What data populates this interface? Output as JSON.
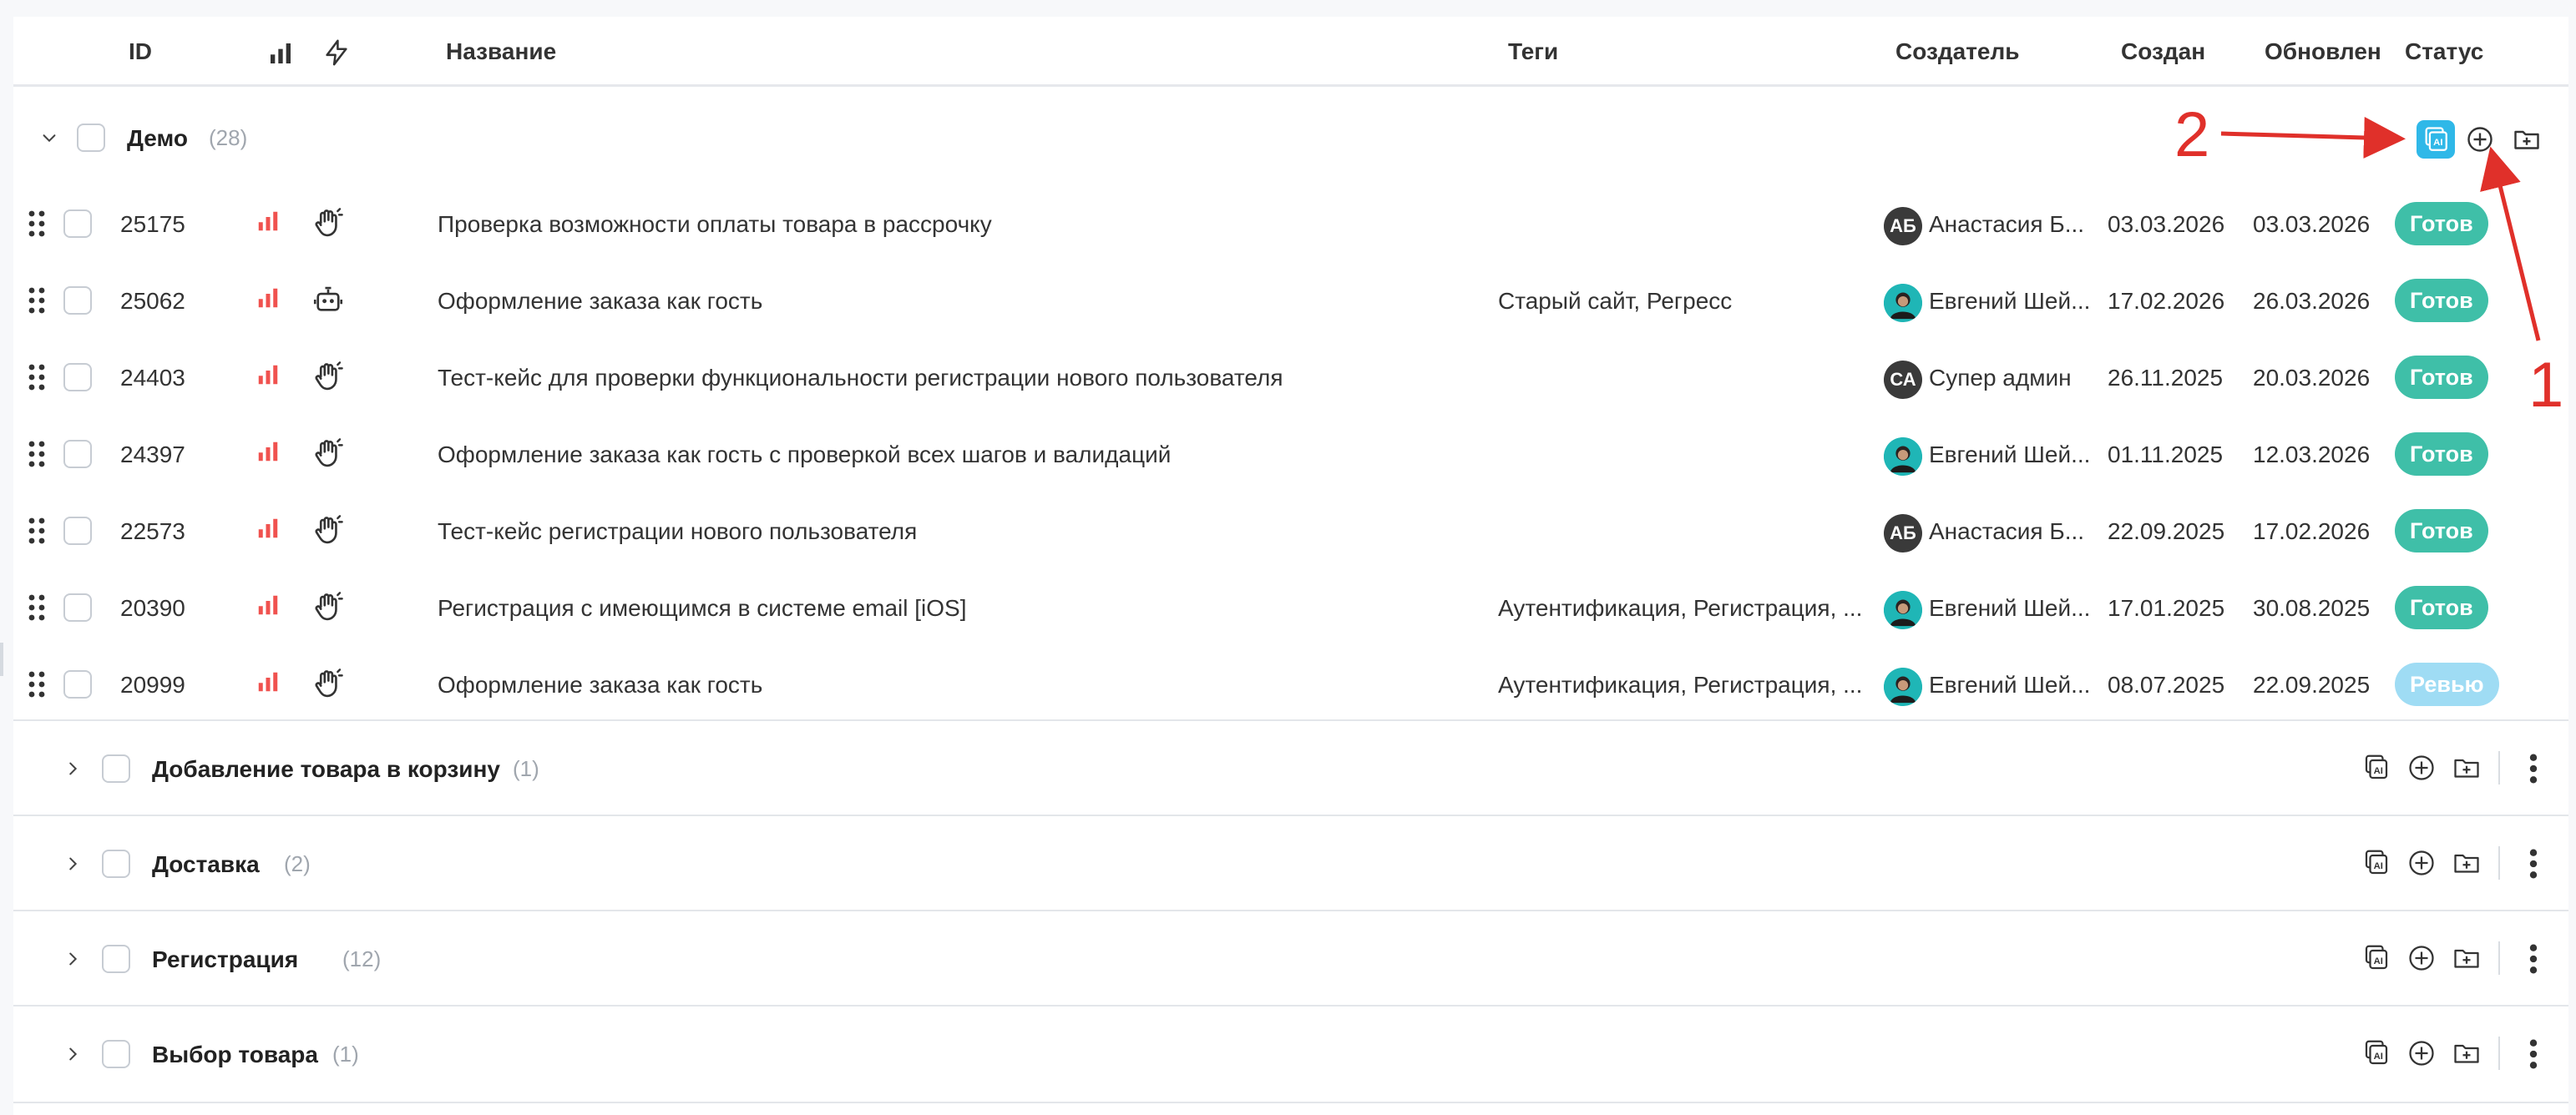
{
  "columns": {
    "id": "ID",
    "name": "Название",
    "tags": "Теги",
    "creator": "Создатель",
    "created": "Создан",
    "updated": "Обновлен",
    "status": "Статус"
  },
  "icons": {
    "priority": "bar-chart-icon",
    "automation": "lightning-icon",
    "manual": "hand-icon",
    "robot": "robot-icon",
    "ai": "ai-copy-icon",
    "add": "plus-circle-icon",
    "folder_add": "folder-plus-icon",
    "more": "kebab-icon",
    "drag": "drag-handle-icon"
  },
  "colors": {
    "accent": "#2fb8e8",
    "status_ready": "#3fbfa8",
    "status_review": "#9fdcf4",
    "priority_high": "#f0524f",
    "annotation": "#e0302a"
  },
  "group_demo": {
    "name": "Демо",
    "count": "(28)"
  },
  "rows": [
    {
      "id": "25175",
      "name": "Проверка возможности оплаты товара в рассрочку",
      "tags": "",
      "avatar": "АБ",
      "creator": "Анастасия Б...",
      "created": "03.03.2026",
      "updated": "03.03.2026",
      "status": "Готов",
      "type": "manual"
    },
    {
      "id": "25062",
      "name": "Оформление заказа как гость",
      "tags": "Старый сайт, Регресс",
      "avatar": "",
      "creator": "Евгений Шей...",
      "created": "17.02.2026",
      "updated": "26.03.2026",
      "status": "Готов",
      "type": "robot"
    },
    {
      "id": "24403",
      "name": "Тест-кейс для проверки функциональности регистрации нового пользователя",
      "tags": "",
      "avatar": "СА",
      "creator": "Супер админ",
      "created": "26.11.2025",
      "updated": "20.03.2026",
      "status": "Готов",
      "type": "manual"
    },
    {
      "id": "24397",
      "name": "Оформление заказа как гость с проверкой всех шагов и валидаций",
      "tags": "",
      "avatar": "",
      "creator": "Евгений Шей...",
      "created": "01.11.2025",
      "updated": "12.03.2026",
      "status": "Готов",
      "type": "manual"
    },
    {
      "id": "22573",
      "name": "Тест-кейс регистрации нового пользователя",
      "tags": "",
      "avatar": "АБ",
      "creator": "Анастасия Б...",
      "created": "22.09.2025",
      "updated": "17.02.2026",
      "status": "Готов",
      "type": "manual"
    },
    {
      "id": "20390",
      "name": "Регистрация с имеющимся в системе email [iOS]",
      "tags": "Аутентификация, Регистрация, ...",
      "avatar": "",
      "creator": "Евгений Шей...",
      "created": "17.01.2025",
      "updated": "30.08.2025",
      "status": "Готов",
      "type": "manual"
    },
    {
      "id": "20999",
      "name": "Оформление заказа как гость",
      "tags": "Аутентификация, Регистрация, ...",
      "avatar": "",
      "creator": "Евгений Шей...",
      "created": "08.07.2025",
      "updated": "22.09.2025",
      "status": "Ревью",
      "type": "manual"
    }
  ],
  "groups": [
    {
      "name": "Добавление товара в корзину",
      "count": "(1)"
    },
    {
      "name": "Доставка",
      "count": "(2)"
    },
    {
      "name": "Регистрация",
      "count": "(12)"
    },
    {
      "name": "Выбор товара",
      "count": "(1)"
    }
  ],
  "annotations": {
    "one": "1",
    "two": "2"
  }
}
